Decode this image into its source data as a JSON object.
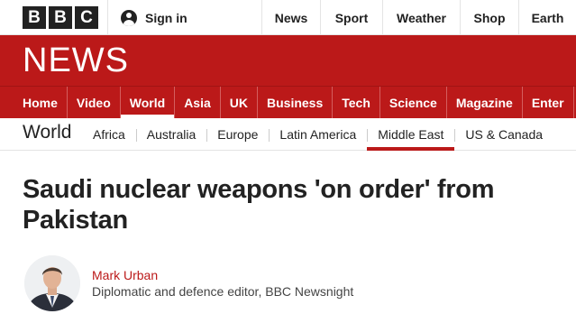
{
  "brand": {
    "logo_letters": [
      "B",
      "B",
      "C"
    ],
    "banner_title": "NEWS",
    "accent_color": "#bb1919"
  },
  "topbar": {
    "signin_label": "Sign in",
    "links": [
      "News",
      "Sport",
      "Weather",
      "Shop",
      "Earth"
    ]
  },
  "primary_nav": {
    "items": [
      "Home",
      "Video",
      "World",
      "Asia",
      "UK",
      "Business",
      "Tech",
      "Science",
      "Magazine",
      "Enter"
    ],
    "active": "World"
  },
  "secondary_nav": {
    "title": "World",
    "items": [
      "Africa",
      "Australia",
      "Europe",
      "Latin America",
      "Middle East",
      "US & Canada"
    ],
    "active": "Middle East"
  },
  "article": {
    "headline": "Saudi nuclear weapons 'on order' from Pakistan",
    "author_name": "Mark Urban",
    "author_role": "Diplomatic and defence editor, BBC Newsnight"
  }
}
